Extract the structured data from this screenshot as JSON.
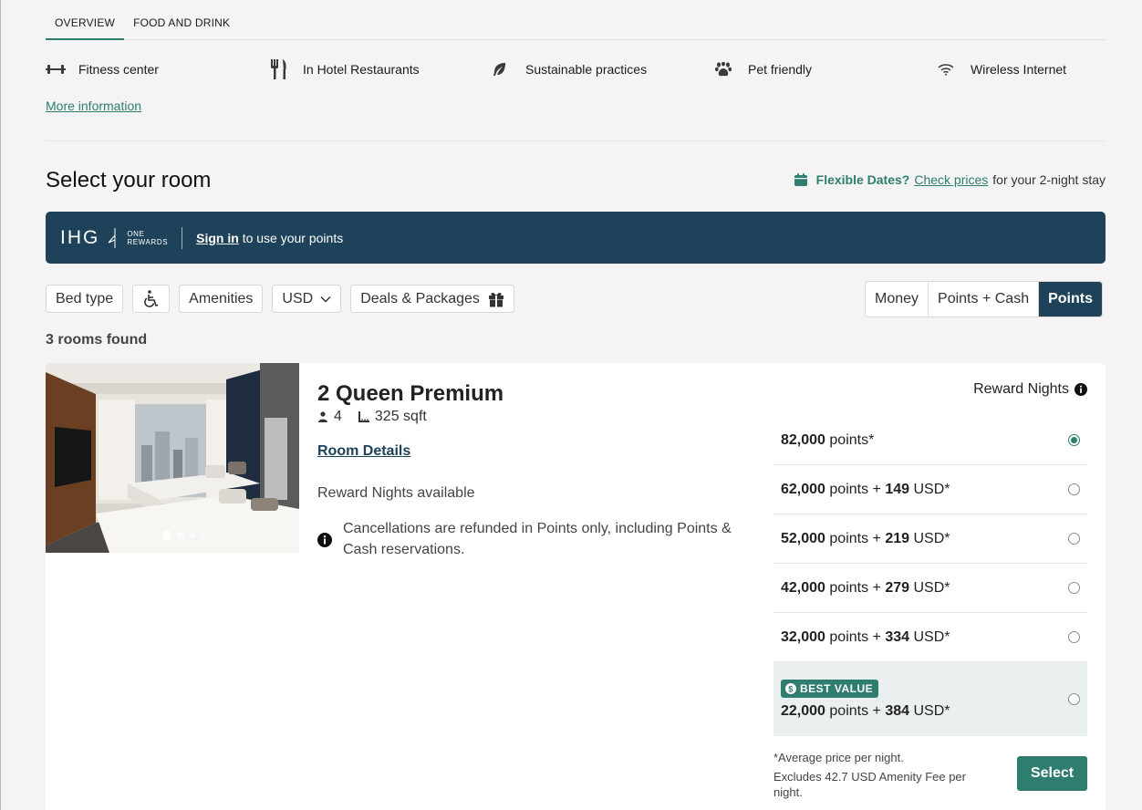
{
  "tabs": [
    {
      "label": "OVERVIEW",
      "active": true
    },
    {
      "label": "FOOD AND DRINK",
      "active": false
    }
  ],
  "amenities": [
    {
      "label": "Fitness center",
      "icon": "dumbbell-icon"
    },
    {
      "label": "In Hotel Restaurants",
      "icon": "fork-knife-icon"
    },
    {
      "label": "Sustainable practices",
      "icon": "leaf-icon"
    },
    {
      "label": "Pet friendly",
      "icon": "paw-icon"
    },
    {
      "label": "Wireless Internet",
      "icon": "wifi-icon"
    }
  ],
  "more_info": "More information",
  "section_title": "Select your room",
  "flexible_dates": {
    "label": "Flexible Dates?",
    "link": "Check prices",
    "rest": "for your 2-night stay"
  },
  "banner": {
    "brand": "IHG",
    "sub_line1": "ONE",
    "sub_line2": "REWARDS",
    "signin": "Sign in",
    "text": " to use your points"
  },
  "filters": {
    "bed_type": "Bed type",
    "amenities": "Amenities",
    "currency": "USD",
    "deals": "Deals & Packages"
  },
  "payment_toggle": [
    {
      "label": "Money",
      "active": false
    },
    {
      "label": "Points + Cash",
      "active": false
    },
    {
      "label": "Points",
      "active": true
    }
  ],
  "rooms_found": "3 rooms found",
  "room": {
    "title": "2 Queen Premium",
    "guests": "4",
    "size": "325 sqft",
    "details_link": "Room Details",
    "reward_available": "Reward Nights available",
    "cancel_note": "Cancellations are refunded in Points only, including Points & Cash reservations.",
    "photo_count": 6,
    "photo_index": 1
  },
  "rates": {
    "header": "Reward Nights",
    "options": [
      {
        "points": "82,000",
        "points_label": "points*",
        "cash": "",
        "cash_label": "",
        "selected": true,
        "best": false
      },
      {
        "points": "62,000",
        "points_label": "points + ",
        "cash": "149",
        "cash_label": "USD*",
        "selected": false,
        "best": false
      },
      {
        "points": "52,000",
        "points_label": "points + ",
        "cash": "219",
        "cash_label": "USD*",
        "selected": false,
        "best": false
      },
      {
        "points": "42,000",
        "points_label": "points + ",
        "cash": "279",
        "cash_label": "USD*",
        "selected": false,
        "best": false
      },
      {
        "points": "32,000",
        "points_label": "points + ",
        "cash": "334",
        "cash_label": "USD*",
        "selected": false,
        "best": false
      }
    ],
    "best": {
      "badge": "BEST VALUE",
      "points": "22,000",
      "points_label": "points + ",
      "cash": "384",
      "cash_label": "USD*",
      "selected": false
    }
  },
  "footnote": {
    "line1": "*Average price per night.",
    "line2": "Excludes 42.7 USD Amenity Fee per night."
  },
  "select_button": "Select",
  "colors": {
    "brand_navy": "#1e4259",
    "accent_green": "#2e7d6e",
    "best_value_bg": "#eaf0ef"
  }
}
